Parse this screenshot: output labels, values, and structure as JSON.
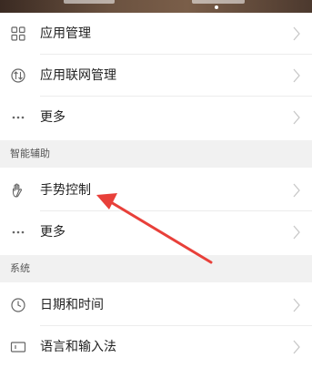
{
  "groups": [
    {
      "items": [
        {
          "label": "应用管理",
          "icon": "grid-icon"
        },
        {
          "label": "应用联网管理",
          "icon": "network-icon"
        },
        {
          "label": "更多",
          "icon": "more-icon"
        }
      ]
    },
    {
      "title": "智能辅助",
      "items": [
        {
          "label": "手势控制",
          "icon": "hand-gesture-icon"
        },
        {
          "label": "更多",
          "icon": "more-icon"
        }
      ]
    },
    {
      "title": "系统",
      "items": [
        {
          "label": "日期和时间",
          "icon": "clock-icon"
        },
        {
          "label": "语言和输入法",
          "icon": "keyboard-icon"
        }
      ]
    }
  ],
  "colors": {
    "annotation_arrow": "#e8403a"
  }
}
